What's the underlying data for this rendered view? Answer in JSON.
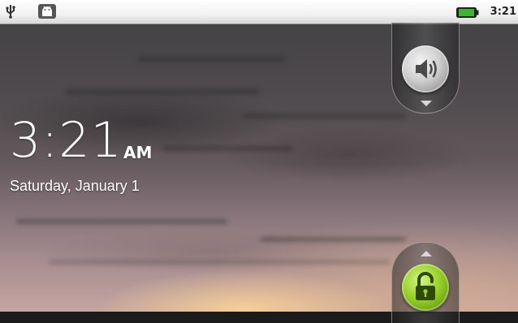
{
  "status_bar": {
    "clock": "3:21",
    "icons": [
      "usb-icon",
      "android-icon",
      "battery-icon"
    ],
    "battery_color": "#3fb62f"
  },
  "lockscreen": {
    "time": "3:21",
    "ampm": "AM",
    "date": "Saturday, January 1",
    "sound_toggle_icon": "speaker-icon",
    "unlock_icon": "unlock-icon",
    "unlock_color": "#9ad12b"
  }
}
